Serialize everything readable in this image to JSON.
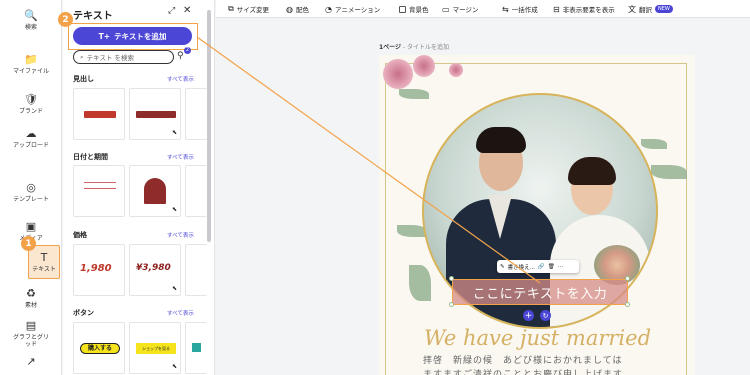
{
  "rail": {
    "items": [
      {
        "icon": "🔍",
        "label": "検索"
      },
      {
        "icon": "📁",
        "label": "マイファイル"
      },
      {
        "icon": "🛡",
        "label": "ブランド"
      },
      {
        "icon": "☁",
        "label": "アップロード"
      },
      {
        "icon": "◎",
        "label": "テンプレート"
      },
      {
        "icon": "▣",
        "label": "メディア"
      },
      {
        "icon": "T",
        "label": "テキスト"
      },
      {
        "icon": "♻",
        "label": "素材"
      },
      {
        "icon": "▤",
        "label": "グラフとグリッド"
      },
      {
        "icon": "↗",
        "label": ""
      }
    ]
  },
  "panel": {
    "title": "テキスト",
    "expand_icon": "⤢",
    "close_icon": "✕",
    "add_button_icon": "T+",
    "add_button_label": "テキストを追加",
    "search_placeholder": "テキスト を検索",
    "filter_count": "2",
    "sections": [
      {
        "title": "見出し",
        "see_all": "すべて表示"
      },
      {
        "title": "日付と期間",
        "see_all": "すべて表示"
      },
      {
        "title": "価格",
        "see_all": "すべて表示"
      },
      {
        "title": "ボタン",
        "see_all": "すべて表示"
      }
    ],
    "thumbs": {
      "price1": "1,980",
      "price2": "¥3,980",
      "button1": "購入する",
      "button2": "ショップを見る"
    }
  },
  "steps": {
    "one": "1",
    "two": "2"
  },
  "toolbar": {
    "resize": "サイズ変更",
    "color": "配色",
    "animation": "アニメーション",
    "background": "背景色",
    "margin": "マージン",
    "batch": "一括作成",
    "hidden": "非表示要素を表示",
    "translate": "翻訳",
    "new": "NEW"
  },
  "canvas": {
    "page_num": "1ページ",
    "page_title": "- タイトルを追加",
    "mini_toolbar_label": "書き換え...",
    "selected_text": "ここにテキストを入力",
    "script_text": "We have just married",
    "jp_line1": "拝啓　新緑の候　あどび様におかれましては",
    "jp_line2": "ますますご清祥のこととお慶び申し上げます"
  },
  "colors": {
    "accent": "#4b46d6",
    "highlight": "#f4a24a",
    "gold": "#d5b064"
  }
}
